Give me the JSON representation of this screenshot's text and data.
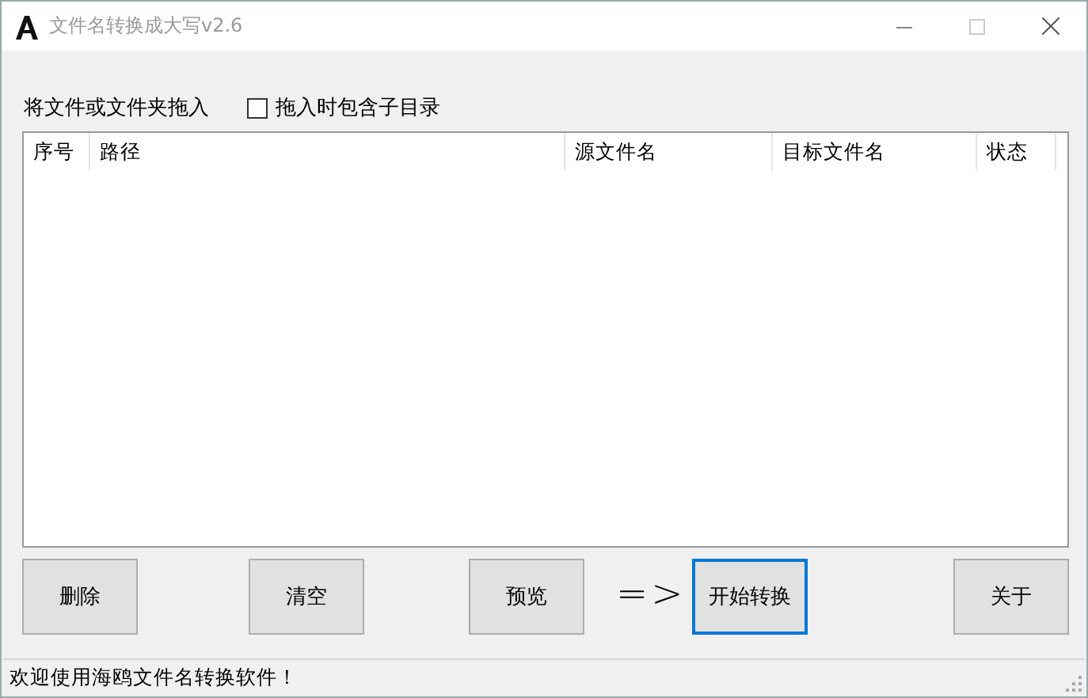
{
  "window": {
    "title": "文件名转换成大写v2.6"
  },
  "drop_label": "将文件或文件夹拖入",
  "include_subdirs": {
    "label": "拖入时包含子目录",
    "checked": false
  },
  "table": {
    "columns": [
      "序号",
      "路径",
      "源文件名",
      "目标文件名",
      "状态"
    ]
  },
  "buttons": [
    {
      "label": "删除",
      "focused": false
    },
    {
      "label": "清空",
      "focused": false
    },
    {
      "label": "预览",
      "focused": false
    },
    {
      "kind": "arrow",
      "label": "=>"
    },
    {
      "label": "开始转换",
      "focused": true
    },
    {
      "label": "关于",
      "focused": false
    }
  ],
  "status_bar": "欢迎使用海鸥文件名转换软件！"
}
